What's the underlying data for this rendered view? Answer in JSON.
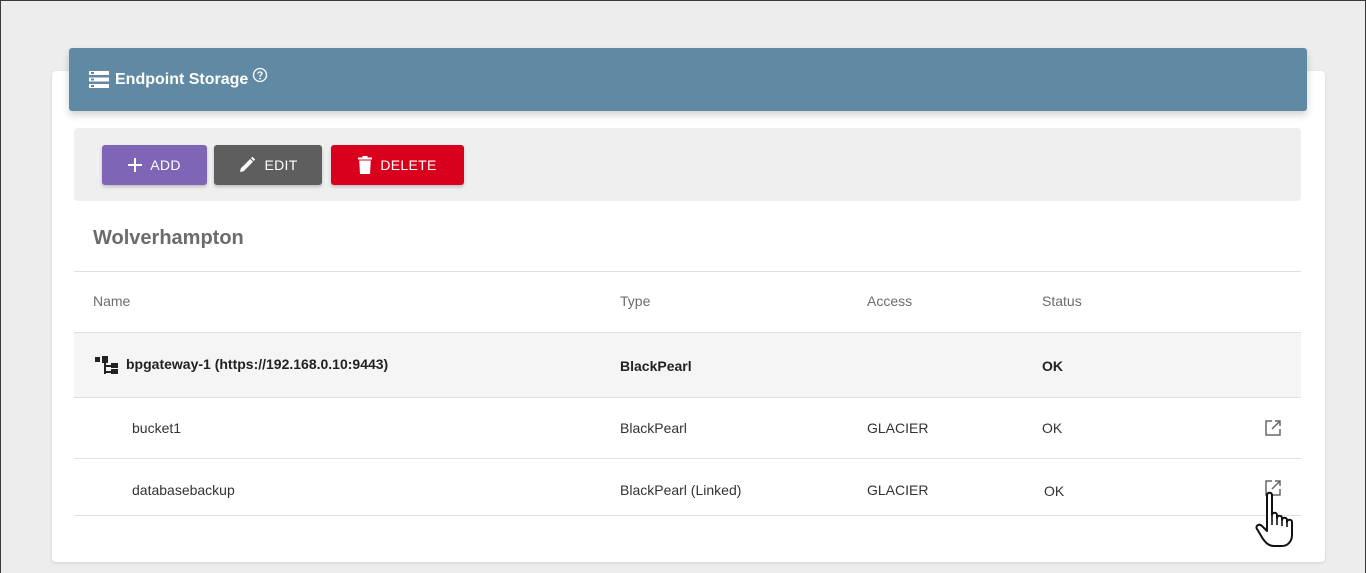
{
  "header": {
    "title": "Endpoint Storage",
    "icon": "storage-list-icon",
    "help_icon": "help-circle-icon"
  },
  "toolbar": {
    "add_label": "ADD",
    "edit_label": "EDIT",
    "delete_label": "DELETE"
  },
  "colors": {
    "header_bg": "#608aa3",
    "add": "#7f65b6",
    "edit": "#5e5e5e",
    "delete": "#d8001c"
  },
  "section": {
    "title": "Wolverhampton"
  },
  "table": {
    "columns": [
      "Name",
      "Type",
      "Access",
      "Status"
    ],
    "rows": [
      {
        "name": "bpgateway-1 (https://192.168.0.10:9443)",
        "type": "BlackPearl",
        "access": "",
        "status": "OK"
      },
      {
        "name": "bucket1",
        "type": "BlackPearl",
        "access": "GLACIER",
        "status": "OK"
      },
      {
        "name": "databasebackup",
        "type": "BlackPearl (Linked)",
        "access": "GLACIER",
        "status": "OK"
      }
    ]
  }
}
